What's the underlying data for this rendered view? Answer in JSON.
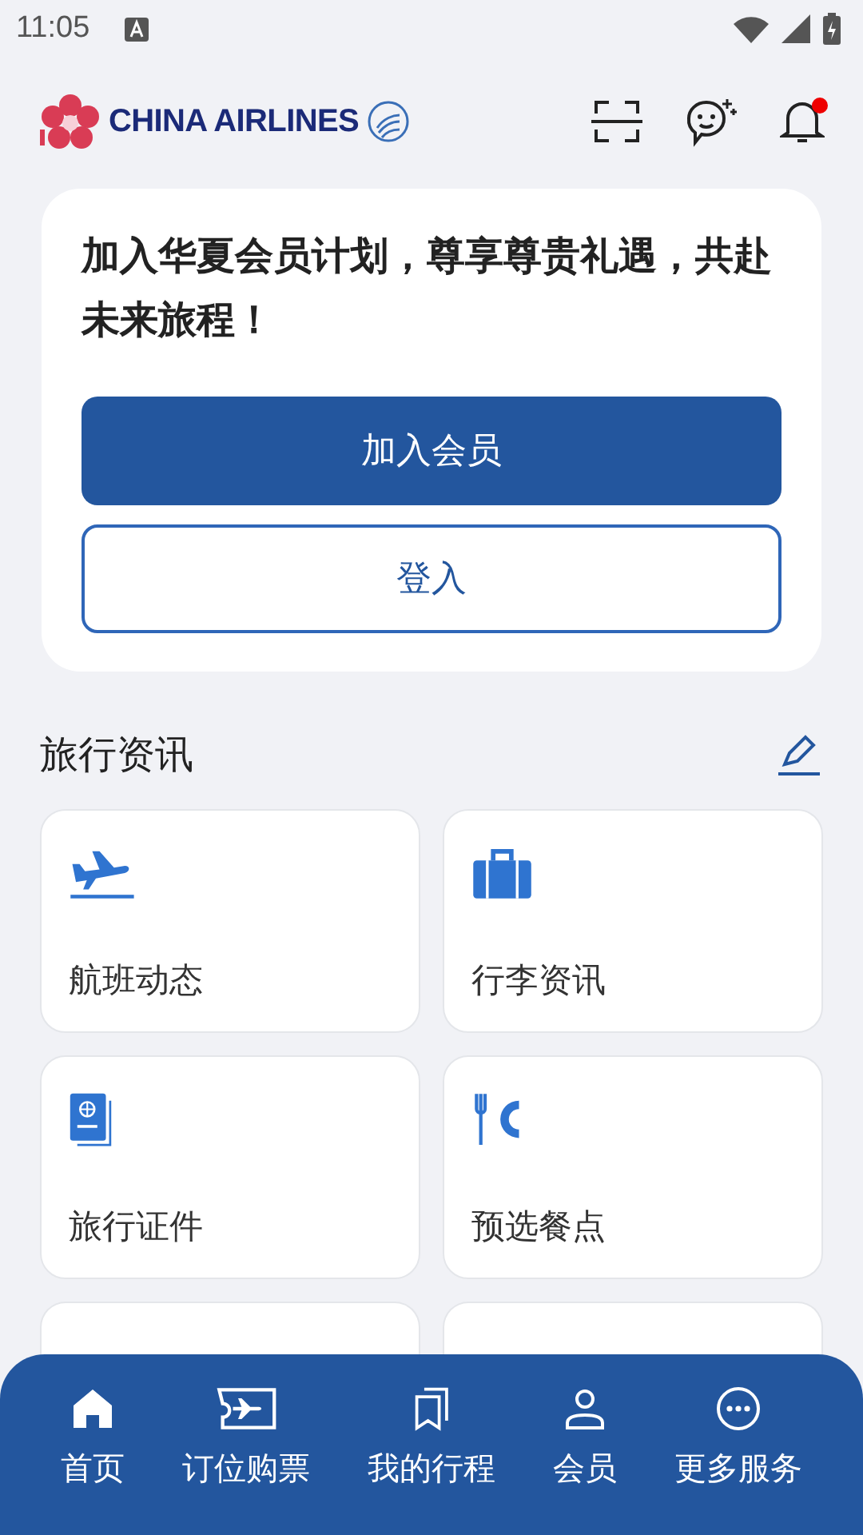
{
  "status_bar": {
    "time": "11:05"
  },
  "header": {
    "logo_text": "CHINA AIRLINES",
    "notification_unread": true
  },
  "promo": {
    "message": "加入华夏会员计划，尊享尊贵礼遇，共赴未来旅程！",
    "primary_button": "加入会员",
    "secondary_button": "登入"
  },
  "travel_info": {
    "title": "旅行资讯",
    "tiles": [
      {
        "label": "航班动态",
        "kind": "flight"
      },
      {
        "label": "行李资讯",
        "kind": "baggage"
      },
      {
        "label": "旅行证件",
        "kind": "passport"
      },
      {
        "label": "预选餐点",
        "kind": "meal"
      },
      {
        "kind": "blank"
      },
      {
        "kind": "blank"
      }
    ]
  },
  "bottom_nav": [
    {
      "label": "首页",
      "kind": "home"
    },
    {
      "label": "订位购票",
      "kind": "ticket"
    },
    {
      "label": "我的行程",
      "kind": "trips"
    },
    {
      "label": "会员",
      "kind": "member"
    },
    {
      "label": "更多服务",
      "kind": "more"
    }
  ]
}
